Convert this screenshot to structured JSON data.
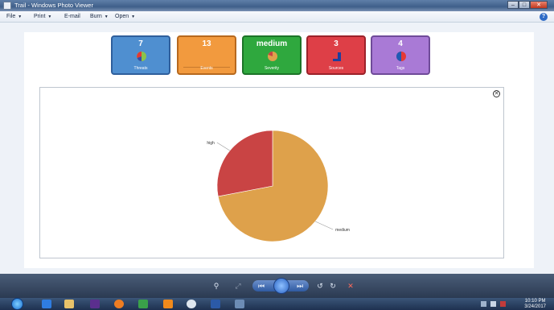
{
  "window": {
    "title": "Trail - Windows Photo Viewer",
    "minimize": "–",
    "maximize": "□",
    "close": "✕"
  },
  "menu": [
    {
      "label": "File"
    },
    {
      "label": "Print"
    },
    {
      "label": "E-mail"
    },
    {
      "label": "Burn"
    },
    {
      "label": "Open"
    }
  ],
  "tiles": {
    "threats": {
      "value": "7",
      "label": "Threats"
    },
    "events": {
      "value": "13",
      "label": "Events"
    },
    "severity": {
      "value": "medium",
      "label": "Severity"
    },
    "sources": {
      "value": "3",
      "label": "Sources"
    },
    "tags": {
      "value": "4",
      "label": "Tags"
    }
  },
  "chart_data": {
    "type": "pie",
    "slices": [
      {
        "label": "medium",
        "value": 72,
        "color": "#dea14b"
      },
      {
        "label": "high",
        "value": 28,
        "color": "#c94444"
      }
    ]
  },
  "toolbar": {
    "zoom": "⚲",
    "fit": "⤢",
    "prev": "⏮",
    "next": "⏭",
    "rotate_ccw": "↺",
    "rotate_cw": "↻",
    "delete": "✕"
  },
  "taskbar": {
    "time": "10:10 PM",
    "date": "3/24/2017"
  }
}
